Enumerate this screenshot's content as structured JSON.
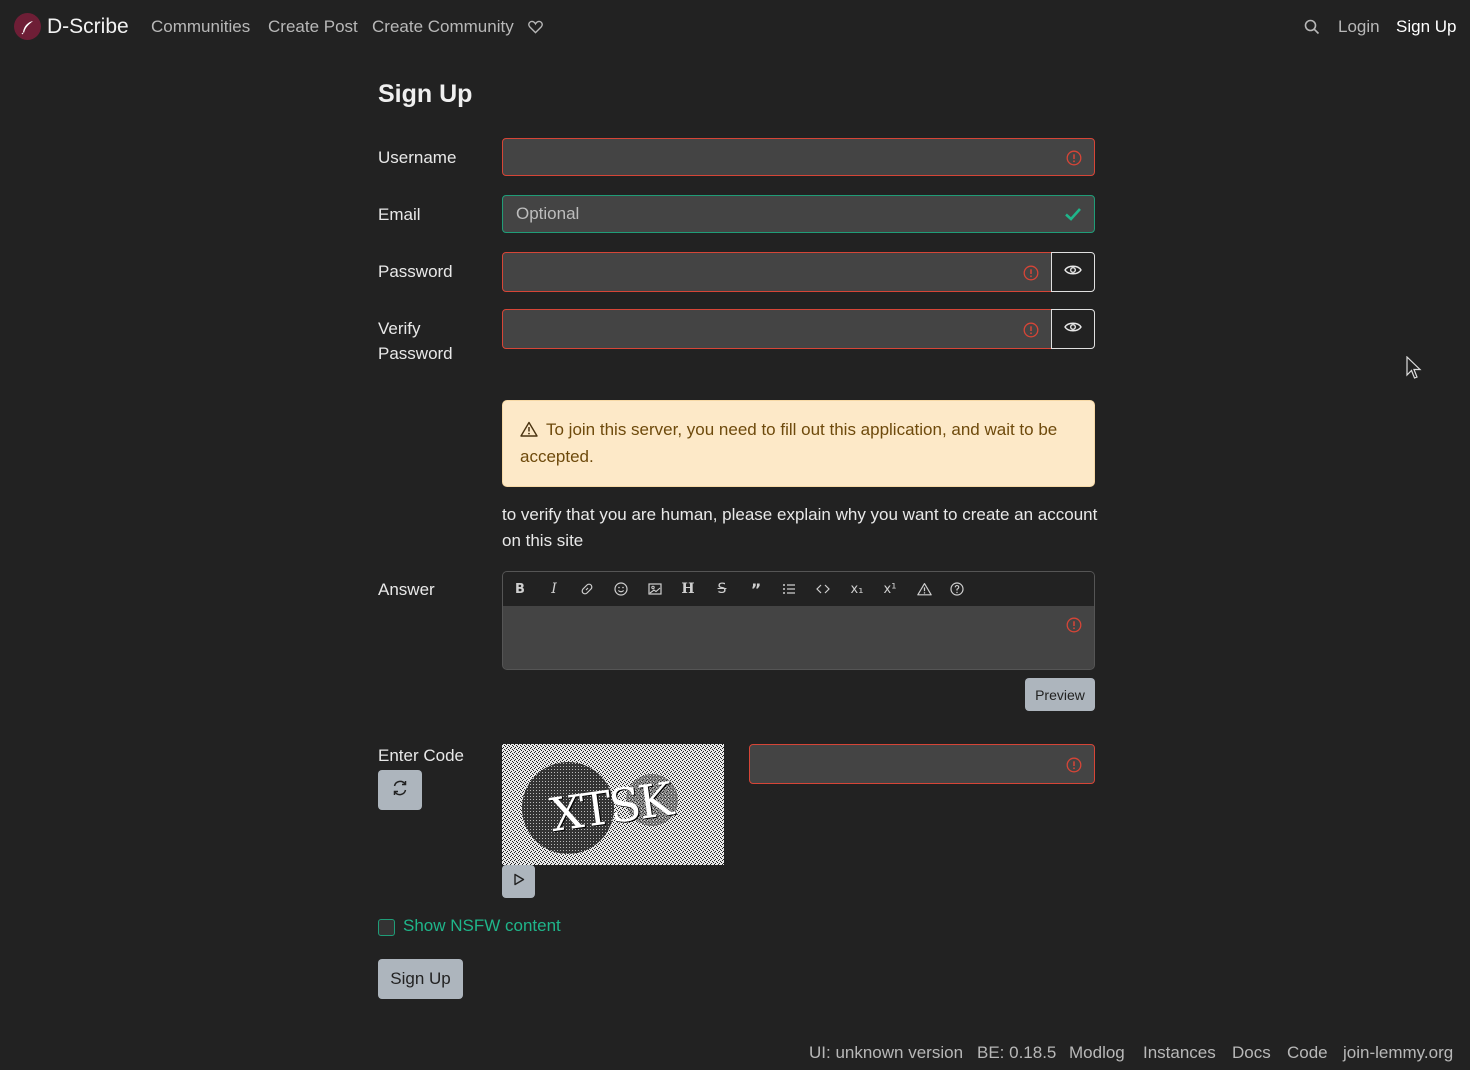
{
  "nav": {
    "brand": "D-Scribe",
    "links": [
      "Communities",
      "Create Post",
      "Create Community"
    ],
    "login": "Login",
    "signup": "Sign Up",
    "icons": [
      "feather-logo-icon",
      "heart-icon",
      "search-icon"
    ]
  },
  "form": {
    "title": "Sign Up",
    "username_label": "Username",
    "email_label": "Email",
    "email_placeholder": "Optional",
    "password_label": "Password",
    "verify_label": "Verify Password",
    "alert": "To join this server, you need to fill out this application, and wait to be accepted.",
    "question": "to verify that you are human, please explain why you want to create an account on this site",
    "answer_label": "Answer",
    "preview_button": "Preview",
    "code_label": "Enter Code",
    "captcha_text": "XTSK",
    "nsfw_label": "Show NSFW content",
    "submit_button": "Sign Up"
  },
  "colors": {
    "background": "#222222",
    "invalid": "#d64537",
    "valid": "#1f9d78",
    "alert_bg": "#fde9c8"
  },
  "footer": {
    "links": [
      "UI: unknown version",
      "BE: 0.18.5",
      "Modlog",
      "Instances",
      "Docs",
      "Code",
      "join-lemmy.org"
    ]
  }
}
